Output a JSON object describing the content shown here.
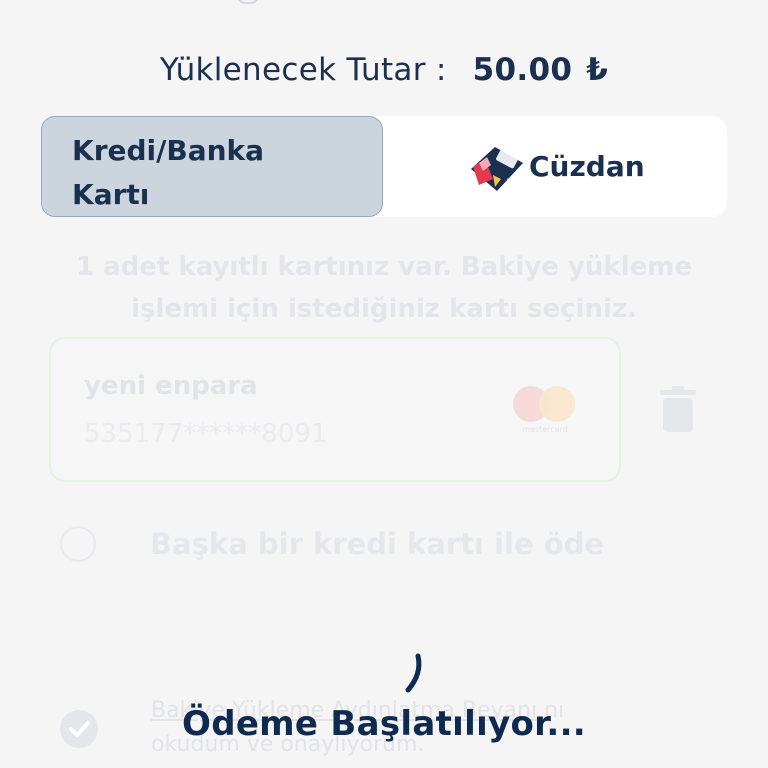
{
  "amount": {
    "label": "Yüklenecek Tutar :",
    "value": "50.00",
    "currency": "₺"
  },
  "tabs": {
    "card_tab_label_line1": "Kredi/Banka",
    "card_tab_label_line2": "Kartı",
    "wallet_tab_label": "Cüzdan"
  },
  "info": {
    "line1": "1 adet kayıtlı kartınız var. Bakiye yükleme",
    "line2": "işlemi için istediğiniz kartı seçiniz."
  },
  "saved_card": {
    "name": "yeni enpara",
    "number": "535177******8091",
    "brand": "mastercard"
  },
  "other_card": {
    "label": "Başka bir kredi kartı ile öde"
  },
  "consent": {
    "link_text": "Bakiye Yükleme Aydınlatma Beyanı",
    "suffix": "nı",
    "line2": "okudum ve onaylıyorum."
  },
  "status": {
    "text": "Ödeme Başlatılıyor..."
  },
  "colors": {
    "primary": "#1b2f4e",
    "tab_active_bg": "#ccd4dd",
    "background": "#f5f5f6"
  }
}
